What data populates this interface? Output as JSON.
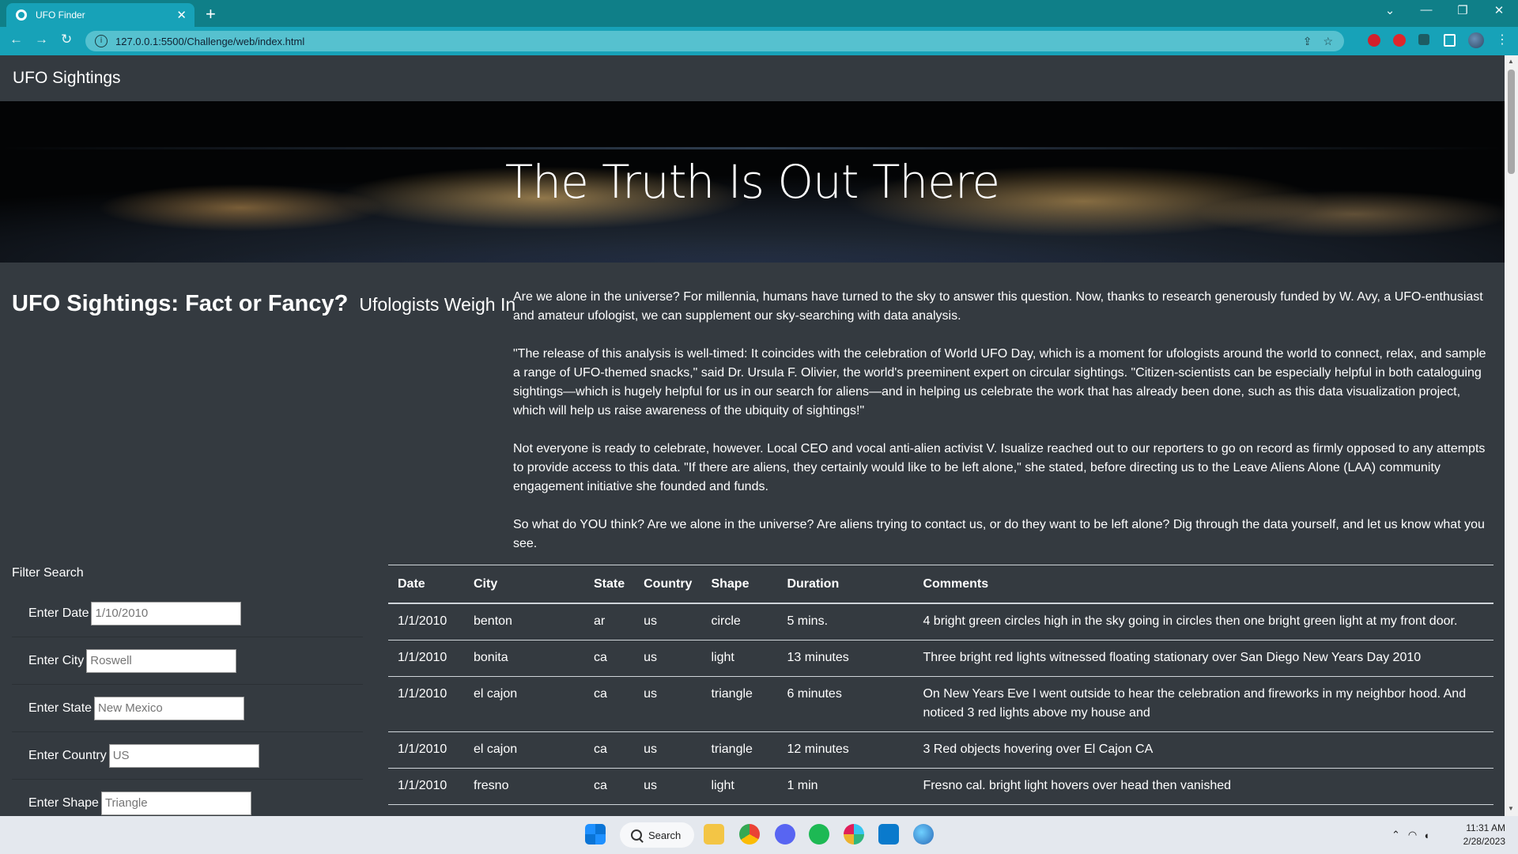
{
  "browser": {
    "tab_title": "UFO Finder",
    "tab_close": "✕",
    "new_tab": "+",
    "url": "127.0.0.1:5500/Challenge/web/index.html",
    "window_controls": [
      "⌄",
      "—",
      "❐",
      "✕"
    ]
  },
  "navbar": {
    "brand": "UFO Sightings"
  },
  "hero": {
    "title": "The Truth Is Out There"
  },
  "article": {
    "heading": "UFO Sightings: Fact or Fancy?",
    "subheading": "Ufologists Weigh In",
    "paragraphs": [
      "Are we alone in the universe? For millennia, humans have turned to the sky to answer this question. Now, thanks to research generously funded by W. Avy, a UFO-enthusiast and amateur ufologist, we can supplement our sky-searching with data analysis.",
      "\"The release of this analysis is well-timed: It coincides with the celebration of World UFO Day, which is a moment for ufologists around the world to connect, relax, and sample a range of UFO-themed snacks,\" said Dr. Ursula F. Olivier, the world's preeminent expert on circular sightings. \"Citizen-scientists can be especially helpful in both cataloguing sightings—which is hugely helpful for us in our search for aliens—and in helping us celebrate the work that has already been done, such as this data visualization project, which will help us raise awareness of the ubiquity of sightings!\"",
      "Not everyone is ready to celebrate, however. Local CEO and vocal anti-alien activist V. Isualize reached out to our reporters to go on record as firmly opposed to any attempts to provide access to this data. \"If there are aliens, they certainly would like to be left alone,\" she stated, before directing us to the Leave Aliens Alone (LAA) community engagement initiative she founded and funds.",
      "So what do YOU think? Are we alone in the universe? Are aliens trying to contact us, or do they want to be left alone? Dig through the data yourself, and let us know what you see."
    ]
  },
  "filters": {
    "title": "Filter Search",
    "items": [
      {
        "label": "Enter Date",
        "placeholder": "1/10/2010"
      },
      {
        "label": "Enter City",
        "placeholder": "Roswell"
      },
      {
        "label": "Enter State",
        "placeholder": "New Mexico"
      },
      {
        "label": "Enter Country",
        "placeholder": "US"
      },
      {
        "label": "Enter Shape",
        "placeholder": "Triangle"
      }
    ]
  },
  "table": {
    "headers": [
      "Date",
      "City",
      "State",
      "Country",
      "Shape",
      "Duration",
      "Comments"
    ],
    "rows": [
      [
        "1/1/2010",
        "benton",
        "ar",
        "us",
        "circle",
        "5 mins.",
        "4 bright green circles high in the sky going in circles then one bright green light at my front door."
      ],
      [
        "1/1/2010",
        "bonita",
        "ca",
        "us",
        "light",
        "13 minutes",
        "Three bright red lights witnessed floating stationary over San Diego New Years Day 2010"
      ],
      [
        "1/1/2010",
        "el cajon",
        "ca",
        "us",
        "triangle",
        "6 minutes",
        "On New Years Eve I went outside to hear the celebration and fireworks in my neighbor hood. And noticed 3 red lights above my house and"
      ],
      [
        "1/1/2010",
        "el cajon",
        "ca",
        "us",
        "triangle",
        "12 minutes",
        "3 Red objects hovering over El Cajon CA"
      ],
      [
        "1/1/2010",
        "fresno",
        "ca",
        "us",
        "light",
        "1 min",
        "Fresno cal. bright light hovers over head then vanished"
      ]
    ]
  },
  "taskbar": {
    "search_label": "Search",
    "time": "11:31 AM",
    "date": "2/28/2023",
    "apps": [
      "windows-start",
      "file-explorer",
      "chrome",
      "discord",
      "spotify",
      "slack",
      "vscode",
      "browser-globe"
    ]
  }
}
